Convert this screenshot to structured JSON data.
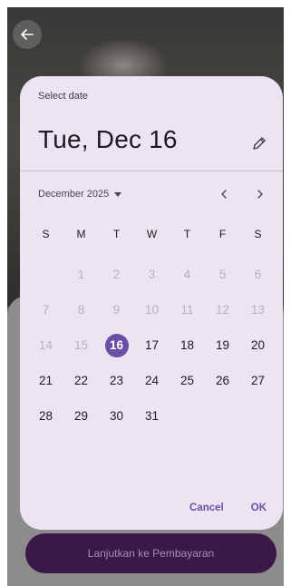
{
  "background": {
    "cta_label": "Lanjutkan ke Pembayaran"
  },
  "dialog": {
    "label": "Select date",
    "headline": "Tue, Dec 16",
    "month_year": "December 2025",
    "weekdays": [
      "S",
      "M",
      "T",
      "W",
      "T",
      "F",
      "S"
    ],
    "weeks": [
      [
        "",
        "1",
        "2",
        "3",
        "4",
        "5",
        "6"
      ],
      [
        "7",
        "8",
        "9",
        "10",
        "11",
        "12",
        "13"
      ],
      [
        "14",
        "15",
        "16",
        "17",
        "18",
        "19",
        "20"
      ],
      [
        "21",
        "22",
        "23",
        "24",
        "25",
        "26",
        "27"
      ],
      [
        "28",
        "29",
        "30",
        "31",
        "",
        "",
        ""
      ]
    ],
    "disabled_days": [
      "1",
      "2",
      "3",
      "4",
      "5",
      "6",
      "7",
      "8",
      "9",
      "10",
      "11",
      "12",
      "13",
      "14",
      "15"
    ],
    "selected_day": "16",
    "cancel_label": "Cancel",
    "ok_label": "OK"
  },
  "icons": {
    "back": "arrow-left-icon",
    "edit": "pencil-icon",
    "prev": "chevron-left-icon",
    "next": "chevron-right-icon",
    "dropdown": "caret-down-icon"
  },
  "colors": {
    "accent": "#6b4fa5",
    "dialog_bg": "#ece4f3",
    "cta_bg": "#3a1848"
  }
}
